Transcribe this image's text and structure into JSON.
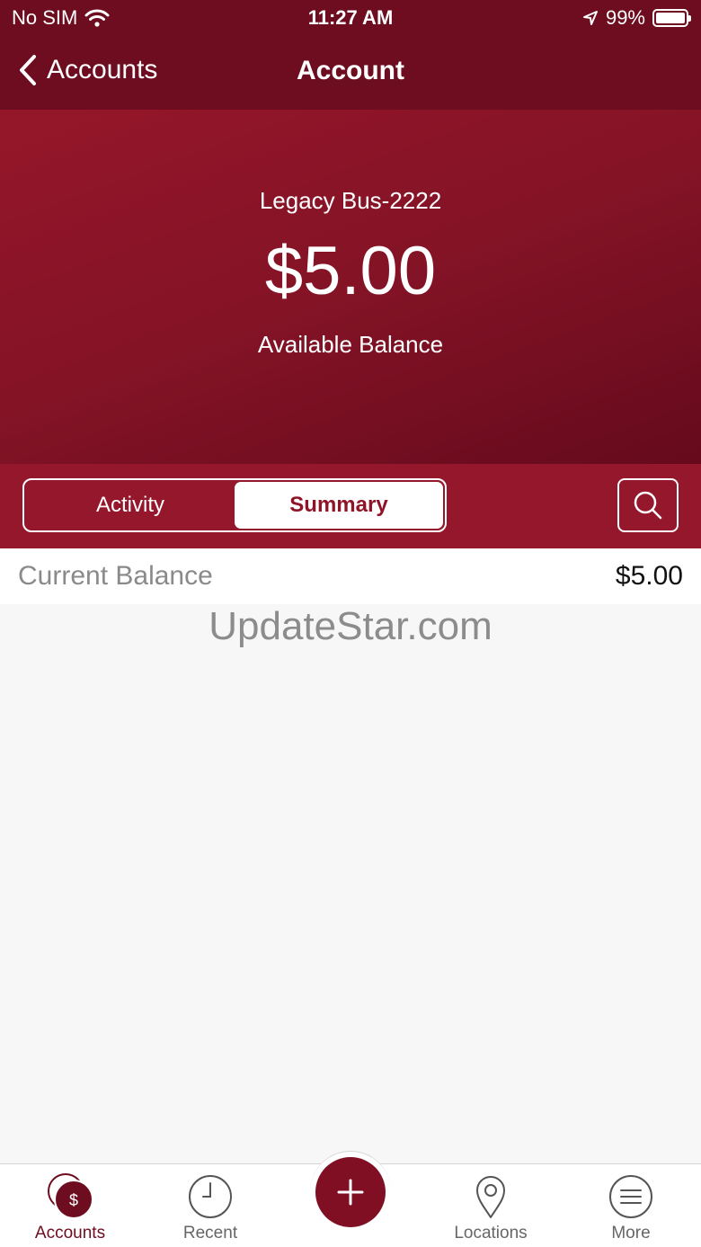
{
  "status": {
    "carrier": "No SIM",
    "time": "11:27 AM",
    "battery": "99%"
  },
  "nav": {
    "back_label": "Accounts",
    "title": "Account"
  },
  "account": {
    "name": "Legacy Bus-2222",
    "balance": "$5.00",
    "balance_label": "Available Balance"
  },
  "tabs": [
    {
      "label": "Activity",
      "active": false
    },
    {
      "label": "Summary",
      "active": true
    }
  ],
  "summary": [
    {
      "label": "Current Balance",
      "value": "$5.00"
    }
  ],
  "watermark": "UpdateStar.com",
  "tabbar": [
    {
      "label": "Accounts",
      "icon": "dollar-coin-icon",
      "active": true
    },
    {
      "label": "Recent",
      "icon": "clock-icon",
      "active": false
    },
    {
      "label": "",
      "icon": "plus-icon",
      "active": false
    },
    {
      "label": "Locations",
      "icon": "location-pin-icon",
      "active": false
    },
    {
      "label": "More",
      "icon": "menu-icon",
      "active": false
    }
  ],
  "colors": {
    "brand_dark": "#6e0d20",
    "brand": "#95172b",
    "accent": "#800f24"
  }
}
